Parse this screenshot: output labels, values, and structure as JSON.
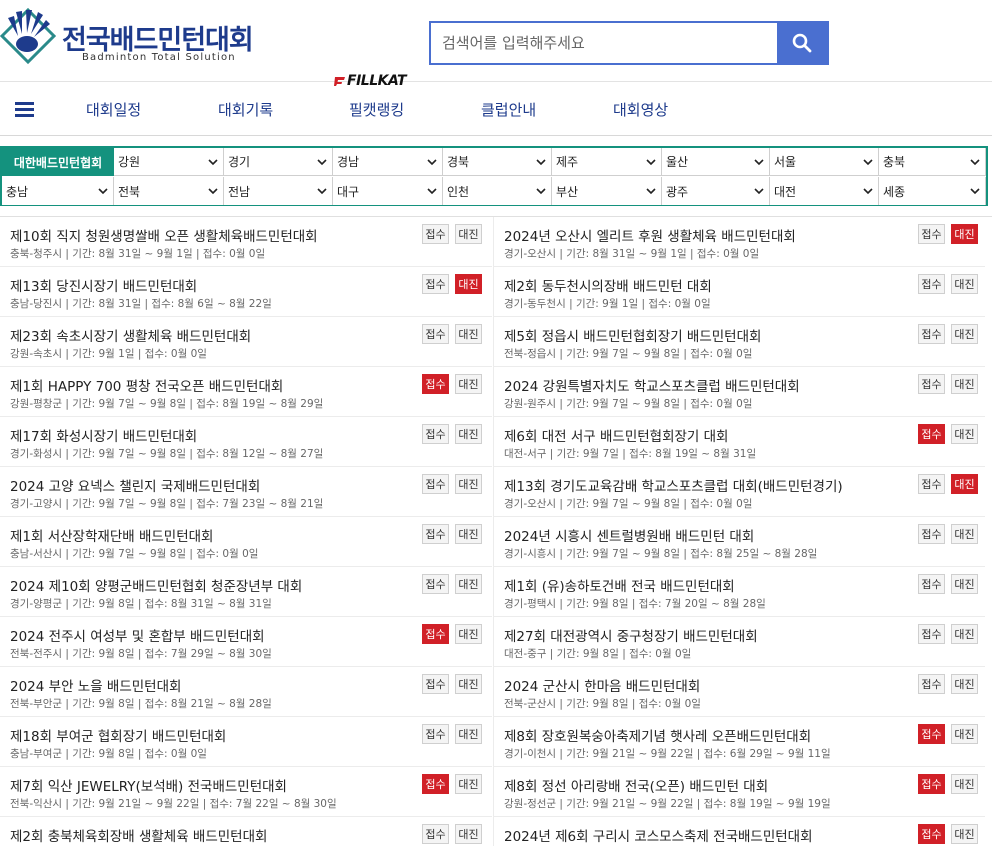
{
  "logo": {
    "title": "전국배드민턴대회",
    "subtitle": "Badminton Total Solution"
  },
  "search": {
    "placeholder": "검색어를 입력해주세요",
    "value": ""
  },
  "nav": {
    "brand": "FILLKAT",
    "items": [
      "대회일정",
      "대회기록",
      "필캣랭킹",
      "클럽안내",
      "대회영상"
    ]
  },
  "regions": {
    "label": "대한배드민턴협회",
    "row1": [
      "강원",
      "경기",
      "경남",
      "경북",
      "제주",
      "울산",
      "서울",
      "충북"
    ],
    "row2": [
      "충남",
      "전북",
      "전남",
      "대구",
      "인천",
      "부산",
      "광주",
      "대전",
      "세종"
    ]
  },
  "badges": {
    "apply": "접수",
    "bracket": "대진"
  },
  "colors": {
    "brand": "#1e3b8c",
    "accent": "#4a6fd0",
    "teal": "#14927e",
    "red": "#d12027"
  },
  "tournaments": {
    "left": [
      {
        "title": "제10회 직지 청원생명쌀배 오픈 생활체육배드민턴대회",
        "meta": "충북-청주시  |  기간: 8월 31일 ~ 9월 1일  |  접수: 0월 0일",
        "apply_active": false,
        "bracket_active": false
      },
      {
        "title": "제13회 당진시장기 배드민턴대회",
        "meta": "충남-당진시  |  기간: 8월 31일  |  접수: 8월 6일 ~ 8월 22일",
        "apply_active": false,
        "bracket_active": true
      },
      {
        "title": "제23회 속초시장기 생활체육 배드민턴대회",
        "meta": "강원-속초시  |  기간: 9월 1일  |  접수: 0월 0일",
        "apply_active": false,
        "bracket_active": false
      },
      {
        "title": "제1회 HAPPY 700 평창 전국오픈 배드민턴대회",
        "meta": "강원-평창군  |  기간: 9월 7일 ~ 9월 8일  |  접수: 8월 19일 ~ 8월 29일",
        "apply_active": true,
        "bracket_active": false
      },
      {
        "title": "제17회 화성시장기 배드민턴대회",
        "meta": "경기-화성시  |  기간: 9월 7일 ~ 9월 8일  |  접수: 8월 12일 ~ 8월 27일",
        "apply_active": false,
        "bracket_active": false
      },
      {
        "title": "2024 고양 요넥스 챌린지 국제배드민턴대회",
        "meta": "경기-고양시  |  기간: 9월 7일 ~ 9월 8일  |  접수: 7월 23일 ~ 8월 21일",
        "apply_active": false,
        "bracket_active": false
      },
      {
        "title": "제1회 서산장학재단배 배드민턴대회",
        "meta": "충남-서산시  |  기간: 9월 7일 ~ 9월 8일  |  접수: 0월 0일",
        "apply_active": false,
        "bracket_active": false
      },
      {
        "title": "2024 제10회 양평군배드민턴협회 청준장년부 대회",
        "meta": "경기-양평군  |  기간: 9월 8일  |  접수: 8월 31일 ~ 8월 31일",
        "apply_active": false,
        "bracket_active": false
      },
      {
        "title": "2024 전주시 여성부 및 혼합부 배드민턴대회",
        "meta": "전북-전주시  |  기간: 9월 8일  |  접수: 7월 29일 ~ 8월 30일",
        "apply_active": true,
        "bracket_active": false
      },
      {
        "title": "2024 부안 노을 배드민턴대회",
        "meta": "전북-부안군  |  기간: 9월 8일  |  접수: 8월 21일 ~ 8월 28일",
        "apply_active": false,
        "bracket_active": false
      },
      {
        "title": "제18회 부여군 협회장기 배드민턴대회",
        "meta": "충남-부여군  |  기간: 9월 8일  |  접수: 0월 0일",
        "apply_active": false,
        "bracket_active": false
      },
      {
        "title": "제7회 익산 JEWELRY(보석배) 전국배드민턴대회",
        "meta": "전북-익산시  |  기간: 9월 21일 ~ 9월 22일  |  접수: 7월 22일 ~ 8월 30일",
        "apply_active": true,
        "bracket_active": false
      },
      {
        "title": "제2회 충북체육회장배 생활체육 배드민턴대회",
        "meta": "",
        "apply_active": false,
        "bracket_active": false
      }
    ],
    "right": [
      {
        "title": "2024년 오산시 엘리트 후원 생활체육 배드민턴대회",
        "meta": "경기-오산시  |  기간: 8월 31일 ~ 9월 1일  |  접수: 0월 0일",
        "apply_active": false,
        "bracket_active": true
      },
      {
        "title": "제2회 동두천시의장배 배드민턴 대회",
        "meta": "경기-동두천시  |  기간: 9월 1일  |  접수: 0월 0일",
        "apply_active": false,
        "bracket_active": false
      },
      {
        "title": "제5회 정읍시 배드민턴협회장기 배드민턴대회",
        "meta": "전북-정읍시  |  기간: 9월 7일 ~ 9월 8일  |  접수: 0월 0일",
        "apply_active": false,
        "bracket_active": false
      },
      {
        "title": "2024 강원특별자치도 학교스포츠클럽 배드민턴대회",
        "meta": "강원-원주시  |  기간: 9월 7일 ~ 9월 8일  |  접수: 0월 0일",
        "apply_active": false,
        "bracket_active": false
      },
      {
        "title": "제6회 대전 서구 배드민턴협회장기 대회",
        "meta": "대전-서구  |  기간: 9월 7일  |  접수: 8월 19일 ~ 8월 31일",
        "apply_active": true,
        "bracket_active": false
      },
      {
        "title": "제13회 경기도교육감배 학교스포츠클럽 대회(배드민턴경기)",
        "meta": "경기-오산시  |  기간: 9월 7일 ~ 9월 8일  |  접수: 0월 0일",
        "apply_active": false,
        "bracket_active": true
      },
      {
        "title": "2024년 시흥시 센트럴병원배 배드민턴 대회",
        "meta": "경기-시흥시  |  기간: 9월 7일 ~ 9월 8일  |  접수: 8월 25일 ~ 8월 28일",
        "apply_active": false,
        "bracket_active": false
      },
      {
        "title": "제1회 (유)송하토건배 전국 배드민턴대회",
        "meta": "경기-평택시  |  기간: 9월 8일  |  접수: 7월 20일 ~ 8월 28일",
        "apply_active": false,
        "bracket_active": false
      },
      {
        "title": "제27회 대전광역시 중구청장기 배드민턴대회",
        "meta": "대전-중구  |  기간: 9월 8일  |  접수: 0월 0일",
        "apply_active": false,
        "bracket_active": false
      },
      {
        "title": "2024 군산시 한마음 배드민턴대회",
        "meta": "전북-군산시  |  기간: 9월 8일  |  접수: 0월 0일",
        "apply_active": false,
        "bracket_active": false
      },
      {
        "title": "제8회 장호원복숭아축제기념 햇사레 오픈배드민턴대회",
        "meta": "경기-이천시  |  기간: 9월 21일 ~ 9월 22일  |  접수: 6월 29일 ~ 9월 11일",
        "apply_active": true,
        "bracket_active": false
      },
      {
        "title": "제8회 정선 아리랑배 전국(오픈) 배드민턴 대회",
        "meta": "강원-정선군  |  기간: 9월 21일 ~ 9월 22일  |  접수: 8월 19일 ~ 9월 19일",
        "apply_active": true,
        "bracket_active": false
      },
      {
        "title": "2024년 제6회 구리시 코스모스축제 전국배드민턴대회",
        "meta": "",
        "apply_active": true,
        "bracket_active": false
      }
    ]
  }
}
